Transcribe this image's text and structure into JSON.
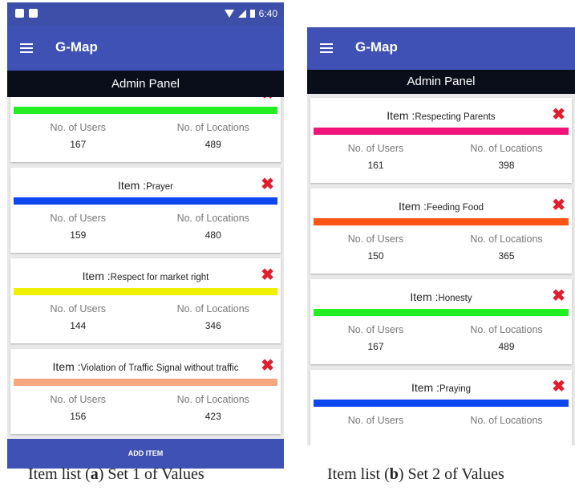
{
  "colors": {
    "primary": "#3f51b5",
    "admin_bar": "#0a0e1a",
    "delete": "#e01e2d"
  },
  "labels": {
    "users": "No. of Users",
    "locations": "No. of Locations",
    "item_prefix": "Item :"
  },
  "screen_a": {
    "status_time": "6:40",
    "app_title": "G-Map",
    "panel_title": "Admin Panel",
    "add_button": "ADD ITEM",
    "cards": [
      {
        "name": "",
        "bar_color": "#22ee22",
        "users": "167",
        "locations": "489"
      },
      {
        "name": "Prayer",
        "bar_color": "#0d47f0",
        "users": "159",
        "locations": "480"
      },
      {
        "name": "Respect for market right",
        "bar_color": "#eef000",
        "users": "144",
        "locations": "346"
      },
      {
        "name": "Violation of Traffic Signal without traffic",
        "bar_color": "#f5a77f",
        "users": "156",
        "locations": "423"
      }
    ],
    "caption_pre": "Item list (",
    "caption_bold": "a",
    "caption_post": ") Set 1 of Values"
  },
  "screen_b": {
    "app_title": "G-Map",
    "panel_title": "Admin Panel",
    "cards": [
      {
        "name": "Respecting Parents",
        "bar_color": "#f0147a",
        "users": "161",
        "locations": "398"
      },
      {
        "name": "Feeding Food",
        "bar_color": "#ff5416",
        "users": "150",
        "locations": "365"
      },
      {
        "name": "Honesty",
        "bar_color": "#22ee22",
        "users": "167",
        "locations": "489"
      },
      {
        "name": "Praying",
        "bar_color": "#0d47f0",
        "users": "",
        "locations": ""
      }
    ],
    "caption_pre": "Item list (",
    "caption_bold": "b",
    "caption_post": ") Set 2 of Values"
  }
}
